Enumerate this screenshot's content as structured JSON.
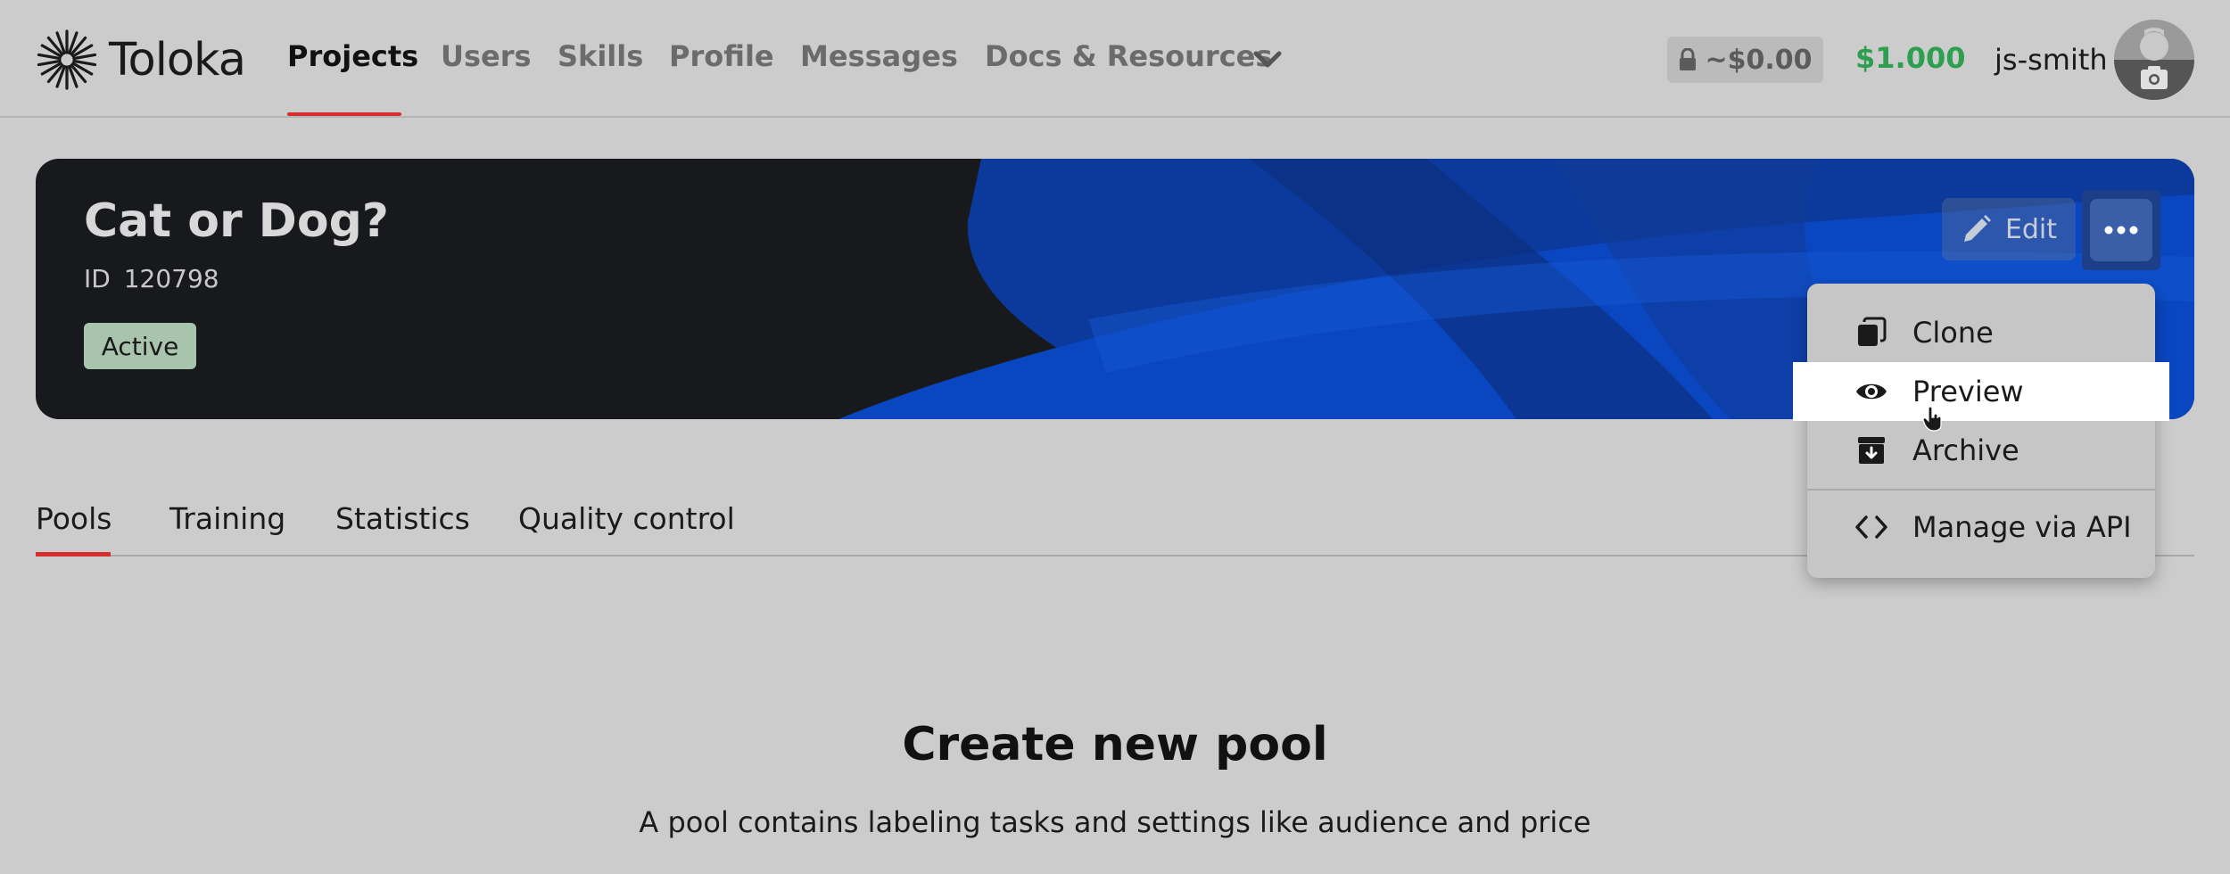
{
  "header": {
    "logo_text": "Toloka",
    "nav": [
      {
        "label": "Projects",
        "active": true
      },
      {
        "label": "Users"
      },
      {
        "label": "Skills"
      },
      {
        "label": "Profile"
      },
      {
        "label": "Messages"
      },
      {
        "label": "Docs & Resources",
        "icon": "chevron-down-icon"
      }
    ],
    "locked_balance": "~$0.00",
    "balance": "$1.000",
    "username": "js-smith"
  },
  "project": {
    "title": "Cat or Dog?",
    "id_label": "ID",
    "id": "120798",
    "status": "Active",
    "edit_label": "Edit"
  },
  "dropdown": {
    "items": [
      {
        "label": "Clone",
        "icon": "copy-icon"
      },
      {
        "label": "Preview",
        "icon": "eye-icon",
        "hovered": true
      },
      {
        "label": "Archive",
        "icon": "archive-icon"
      },
      {
        "label": "Manage via API",
        "icon": "code-icon"
      }
    ]
  },
  "tabs": [
    {
      "label": "Pools",
      "active": true
    },
    {
      "label": "Training"
    },
    {
      "label": "Statistics"
    },
    {
      "label": "Quality control"
    }
  ],
  "empty_state": {
    "title": "Create new pool",
    "description": "A pool contains labeling tasks and settings like audience and price"
  },
  "colors": {
    "accent_red": "#d32f2f",
    "balance_green": "#2e9e4f",
    "banner_dark": "#18191d",
    "banner_blue": "#0a3fa8"
  }
}
